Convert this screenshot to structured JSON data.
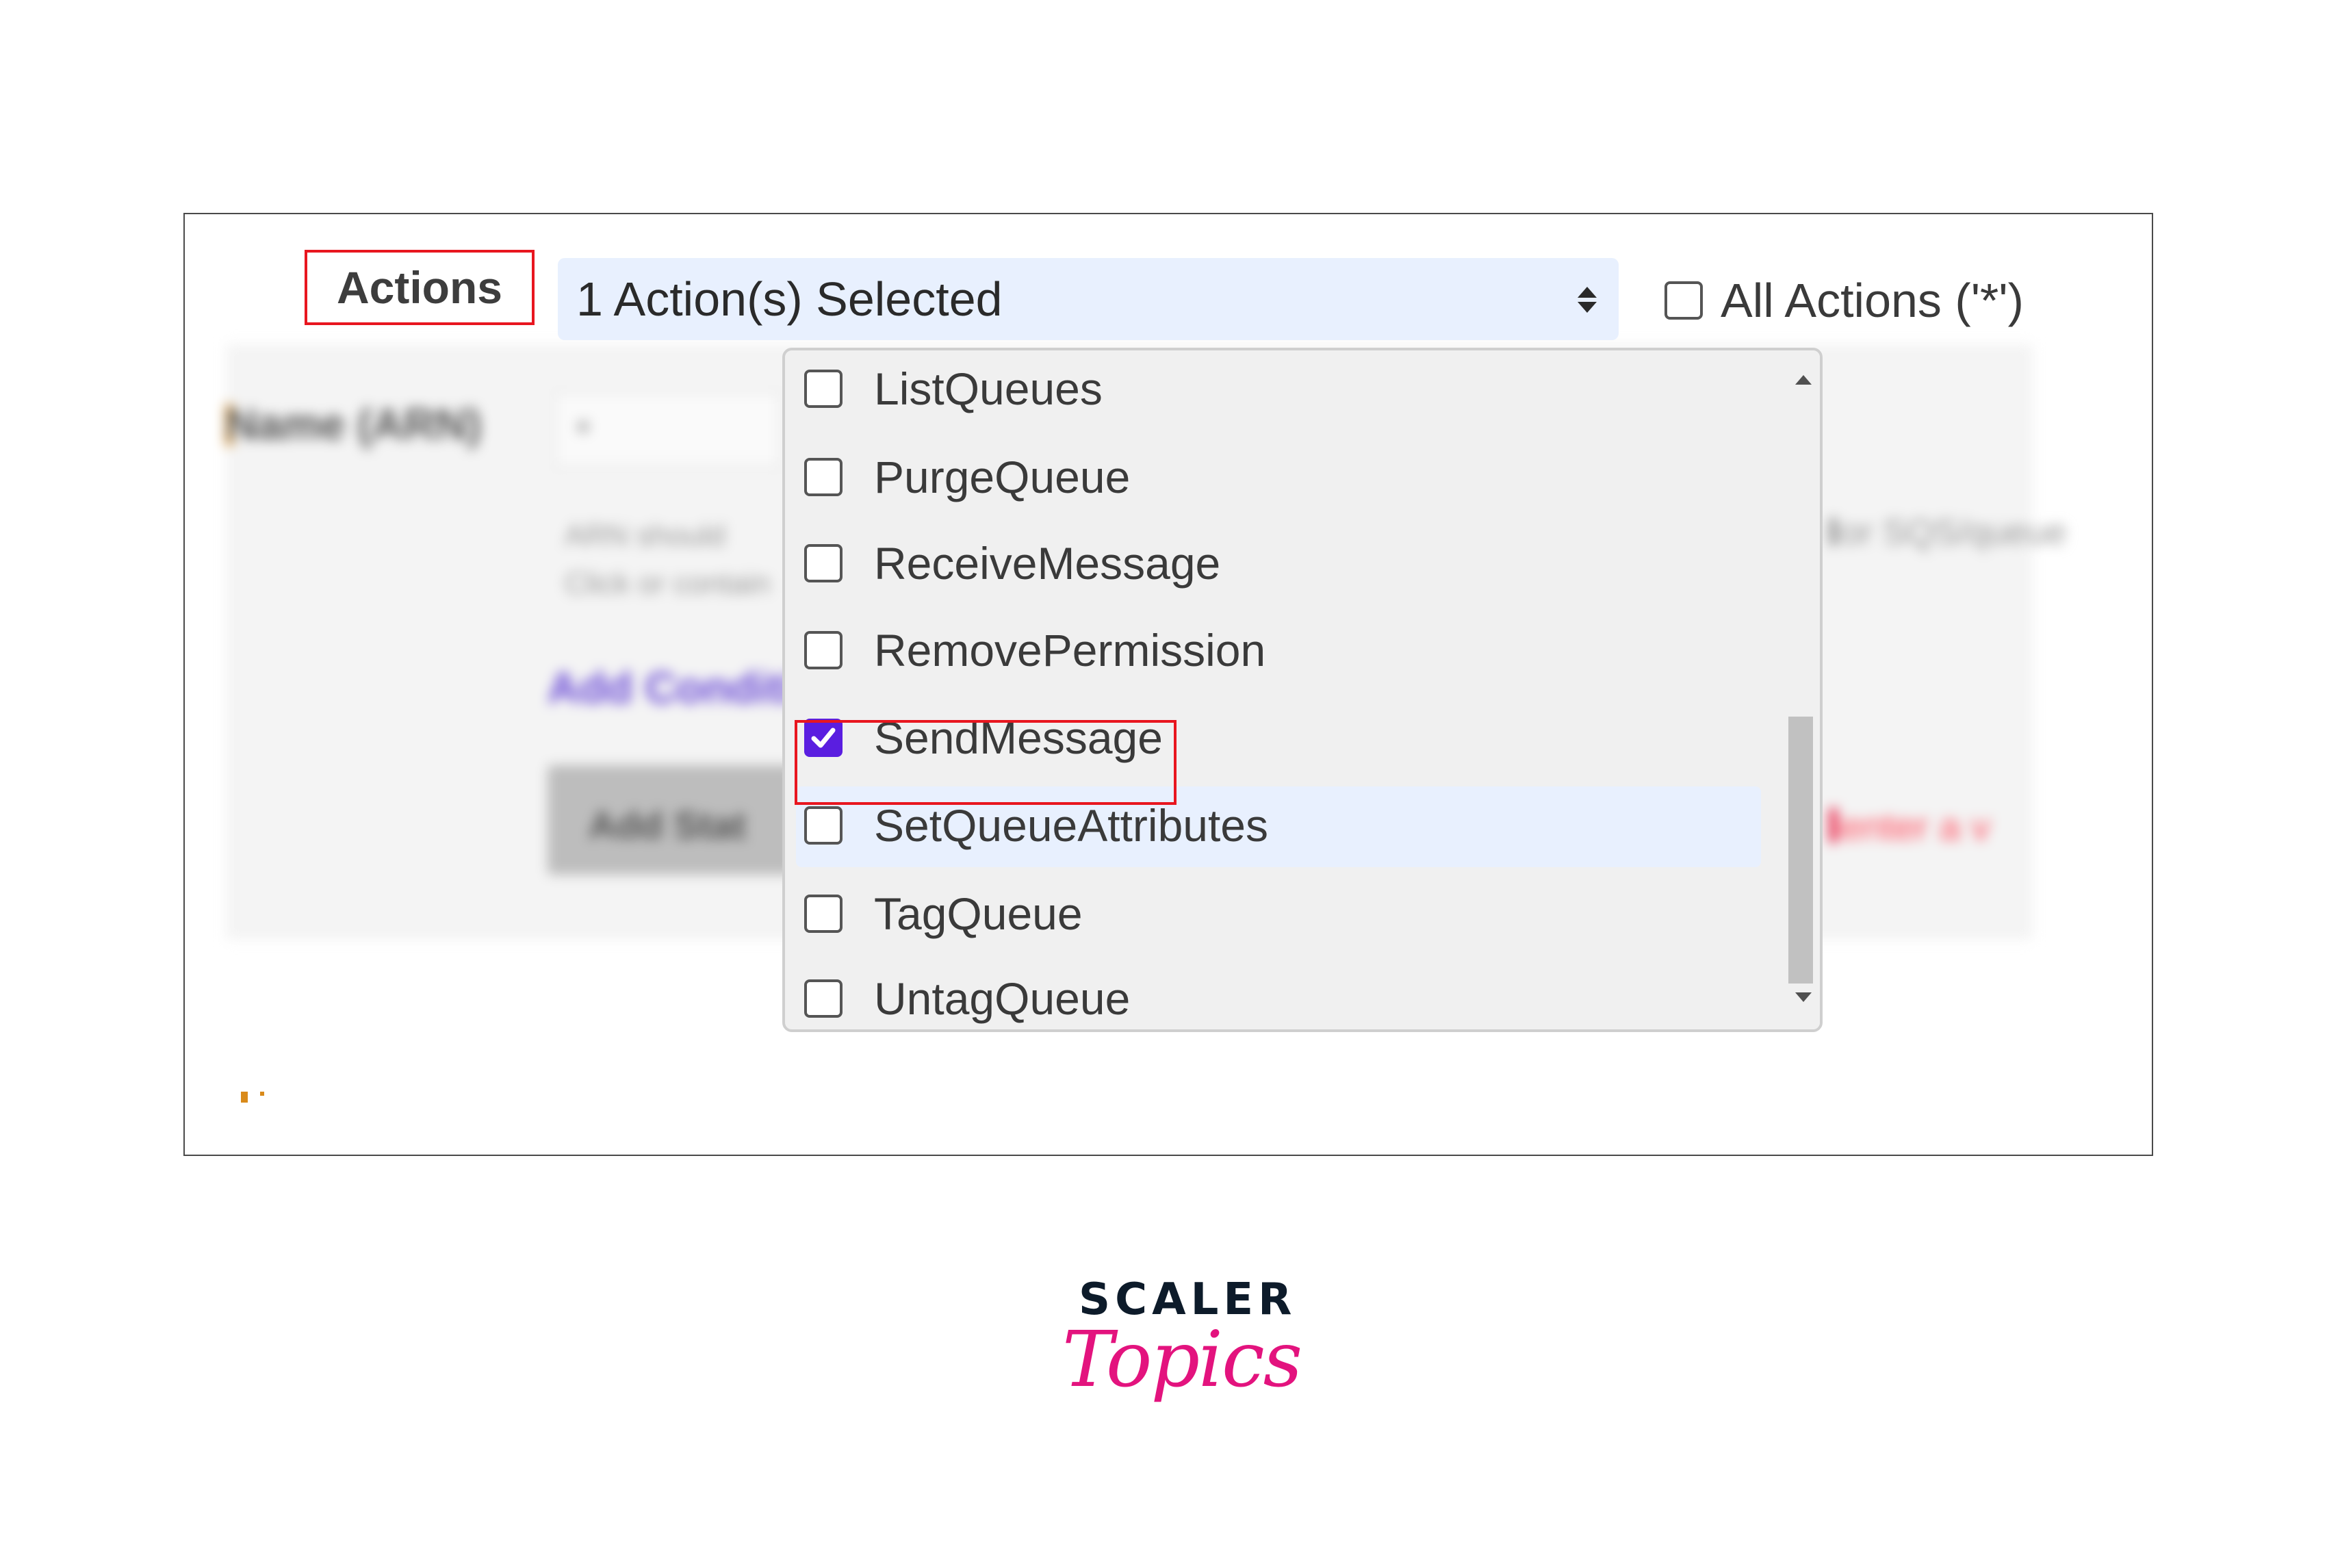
{
  "actions_label": "Actions",
  "select": {
    "value": "1 Action(s) Selected"
  },
  "all_actions": {
    "label": "All Actions ('*')",
    "checked": false
  },
  "dropdown": {
    "options": [
      {
        "label": "ListQueues",
        "checked": false
      },
      {
        "label": "PurgeQueue",
        "checked": false
      },
      {
        "label": "ReceiveMessage",
        "checked": false
      },
      {
        "label": "RemovePermission",
        "checked": false
      },
      {
        "label": "SendMessage",
        "checked": true
      },
      {
        "label": "SetQueueAttributes",
        "checked": false
      },
      {
        "label": "TagQueue",
        "checked": false
      },
      {
        "label": "UntagQueue",
        "checked": false
      }
    ]
  },
  "background": {
    "arn_label": "Name (ARN)",
    "arn_input": "*",
    "arn_help": "ARN should\nClick or contain",
    "add_conditions": "Add Conditi",
    "add_button": "Add Stat",
    "right_note": "or SQS/queue",
    "right_error": "enter a v"
  },
  "logo": {
    "top": "SCALER",
    "bottom": "Topics"
  },
  "colors": {
    "highlight_red": "#e8161f",
    "checkbox_checked": "#5a1ee0",
    "select_bg": "#e8f0fe",
    "logo_pink": "#e3137e",
    "logo_navy": "#0d1b2a"
  }
}
